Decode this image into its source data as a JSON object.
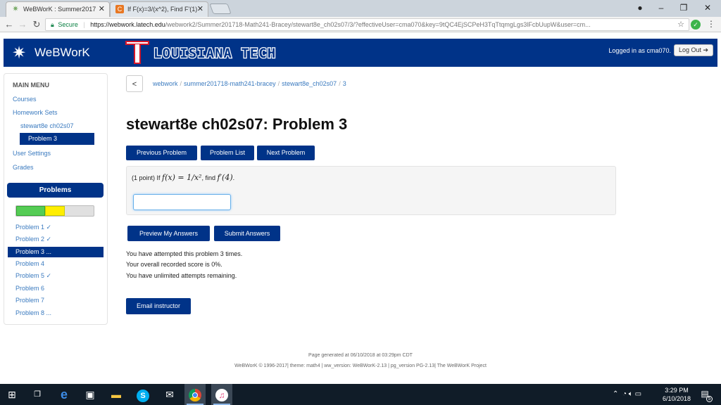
{
  "browser": {
    "tabs": [
      {
        "label": "WeBWorK : Summer2017",
        "icon": "webwork-star-icon",
        "active": true
      },
      {
        "label": "If F(x)=3/(x^2), Find F'(1)",
        "icon": "chegg-icon",
        "active": false
      }
    ],
    "url_secure_label": "Secure",
    "url_host": "https://webwork.latech.edu",
    "url_path": "/webwork2/Summer201718-Math241-Bracey/stewart8e_ch02s07/3/?effectiveUser=cma070&key=9tQC4EjSCPeH3TqTtqmgLgs3lFcbUupW&user=cm..."
  },
  "header": {
    "app_name": "WeBWorK",
    "university": "LOUISIANA TECH",
    "logged_in_text": "Logged in as cma070.",
    "logout_label": "Log Out"
  },
  "menu": {
    "title": "MAIN MENU",
    "courses": "Courses",
    "homework_sets": "Homework Sets",
    "current_set": "stewart8e ch02s07",
    "current_problem": "Problem 3",
    "user_settings": "User Settings",
    "grades": "Grades"
  },
  "problems_panel": {
    "title": "Problems",
    "progress": {
      "correct_fraction": 0.375,
      "attempted_fraction": 0.25
    },
    "items": [
      {
        "label": "Problem 1 ✓"
      },
      {
        "label": "Problem 2 ✓"
      },
      {
        "label": "Problem 3 ..."
      },
      {
        "label": "Problem 4"
      },
      {
        "label": "Problem 5 ✓"
      },
      {
        "label": "Problem 6"
      },
      {
        "label": "Problem 7"
      },
      {
        "label": "Problem 8 ..."
      }
    ]
  },
  "breadcrumb": {
    "back_label": "<",
    "items": [
      "webwork",
      "summer201718-math241-bracey",
      "stewart8e_ch02s07",
      "3"
    ]
  },
  "page_title": "stewart8e ch02s07: Problem 3",
  "nav_buttons": {
    "previous": "Previous Problem",
    "list": "Problem List",
    "next": "Next Problem"
  },
  "problem": {
    "points": "(1 point) If",
    "function": "f(x) = 1/x²",
    "find_text": ", find",
    "target": "f′(4)",
    "answer_value": ""
  },
  "submit_buttons": {
    "preview": "Preview My Answers",
    "submit": "Submit Answers"
  },
  "status": {
    "attempts": "You have attempted this problem 3 times.",
    "score": "Your overall recorded score is 0%.",
    "remaining": "You have unlimited attempts remaining."
  },
  "email_label": "Email instructor",
  "footer": {
    "generated": "Page generated at 06/10/2018 at 03:29pm CDT",
    "version": "WeBWorK © 1996-2017| theme: math4 | ww_version: WeBWorK-2.13 | pg_version PG-2.13| The WeBWorK Project"
  },
  "taskbar": {
    "time": "3:29 PM",
    "date": "6/10/2018",
    "notification_count": "5"
  },
  "colors": {
    "brand_navy": "#003388",
    "link_blue": "#3a7abf",
    "lt_red": "#d7182a"
  }
}
